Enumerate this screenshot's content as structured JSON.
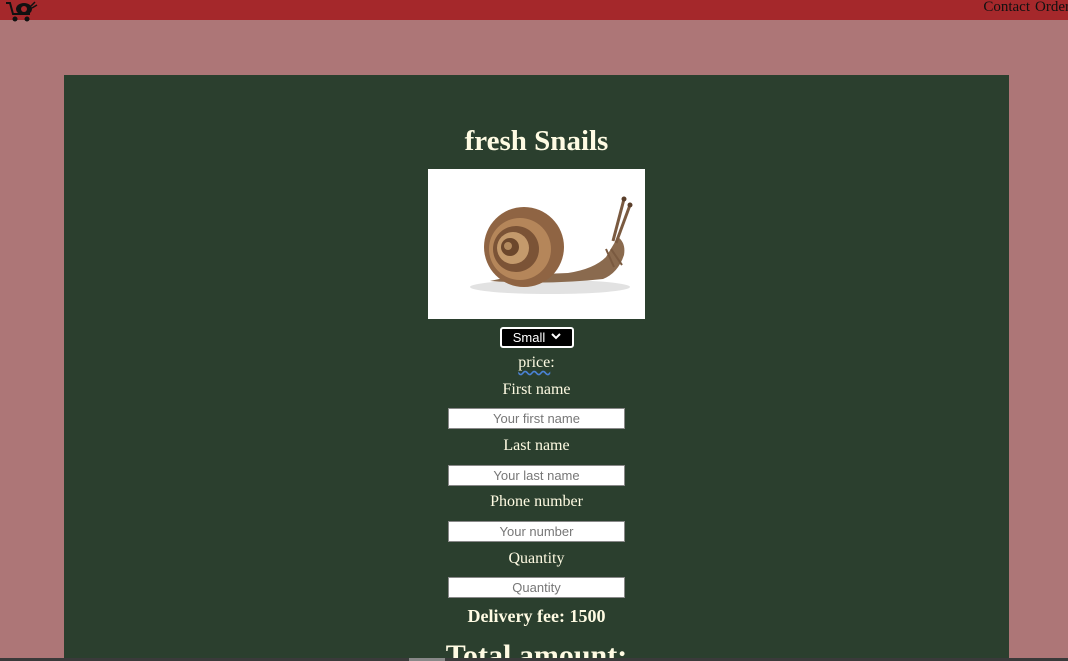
{
  "nav": {
    "items": [
      "Contact",
      "Order"
    ]
  },
  "product": {
    "title": "fresh Snails",
    "size_selected": "Small",
    "price_label": "price",
    "price_suffix": ":"
  },
  "form": {
    "first_name_label": "First name",
    "first_name_placeholder": "Your first name",
    "last_name_label": "Last name",
    "last_name_placeholder": "Your last name",
    "phone_label": "Phone number",
    "phone_placeholder": "Your number",
    "quantity_label": "Quantity",
    "quantity_placeholder": "Quantity"
  },
  "summary": {
    "delivery_fee": "Delivery fee: 1500",
    "total_amount": "Total amount:"
  },
  "colors": {
    "page_bg": "#ad7677",
    "topbar_bg": "#a5282b",
    "panel_bg": "#2b3f2e",
    "text": "#fffbe3"
  },
  "icons": {
    "logo": "snail-cart-logo",
    "chevron": "chevron-down-icon"
  }
}
